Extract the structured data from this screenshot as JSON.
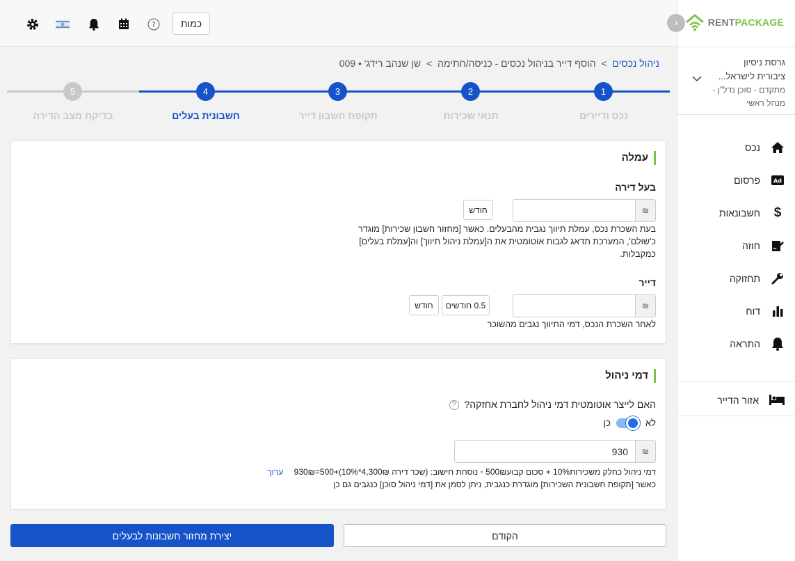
{
  "app": {
    "logo_rent": "RENT",
    "logo_package": "PACKAGE",
    "colors": {
      "primary": "#1652c8",
      "accent_green": "#7cc242",
      "inactive": "#c8c8c8"
    }
  },
  "header": {
    "quantity_button": "כמות",
    "icons": [
      "gear-icon",
      "israel-flag-icon",
      "bell-icon",
      "calendar-icon",
      "help-icon"
    ]
  },
  "account": {
    "name": "גרסת ניסיון ציבורית לישראל...",
    "name_line1": "גרסת ניסיון",
    "name_line2": "ציבורית לישראל...",
    "role_line1": "מתקדם - סוכן נדל\"ן -",
    "role_line2": "מנהל ראשי"
  },
  "sidebar": {
    "items": [
      {
        "label": "נכס",
        "icon": "home-icon"
      },
      {
        "label": "פרסום",
        "icon": "ad-icon"
      },
      {
        "label": "חשבונאות",
        "icon": "dollar-icon"
      },
      {
        "label": "חוזה",
        "icon": "contract-icon"
      },
      {
        "label": "תחזוקה",
        "icon": "wrench-icon"
      },
      {
        "label": "דוח",
        "icon": "bar-chart-icon"
      },
      {
        "label": "התראה",
        "icon": "bell-icon"
      }
    ],
    "tenant_zone": "אזור הדייר"
  },
  "breadcrumb": {
    "root": "ניהול נכסים",
    "sep": ">",
    "page": "הוסף דייר בניהול נכסים - כניסה/חתימה",
    "sep2": ">",
    "tenant": "שן שנהב רידג' • 009"
  },
  "stepper": {
    "steps": [
      {
        "num": "1",
        "label": "נכס ודיירים",
        "state": "done"
      },
      {
        "num": "2",
        "label": "תנאי שכירות",
        "state": "done"
      },
      {
        "num": "3",
        "label": "תקופת חשבון דייר",
        "state": "done"
      },
      {
        "num": "4",
        "label": "חשבונית בעלים",
        "state": "active"
      },
      {
        "num": "5",
        "label": "בדיקת מצב הדירה",
        "state": "pending"
      }
    ]
  },
  "commission": {
    "title": "עמלה",
    "owner": {
      "label": "בעל דירה",
      "currency": "₪",
      "value": "",
      "unit_chip": "חודש",
      "desc_line1": "בעת השכרת נכס, עמלת תיווך נגבית מהבעלים. כאשר [מחזור חשבון שכירות] מוגדר",
      "desc_line2": "כ'שולם', המערכת תדאג לגבות אוטומטית את ה[עמלת ניהול תיווך] וה[עמלת בעלים]",
      "desc_line3": "כמקבלות."
    },
    "tenant": {
      "label": "דייר",
      "currency": "₪",
      "value": "",
      "months_chip": "0.5 חודשים",
      "unit_chip": "חודש",
      "desc": "לאחר השכרת הנכס, דמי התיווך נגבים מהשוכר"
    }
  },
  "management": {
    "title": "דמי ניהול",
    "question": "האם לייצר אוטומטית דמי ניהול לחברת אחזקה?",
    "toggle_no": "לא",
    "toggle_yes": "כן",
    "toggle_on": true,
    "currency": "₪",
    "value": "930",
    "formula": "דמי ניהול כחלק משכירות10% + סכום קבוע500₪ ◦ נוסחת חישוב: (שכר דירה 4,300₪*10%)+500=930₪",
    "edit_link": "ערוך",
    "note": "כאשר [תקופת חשבונית השכירות] מוגדרת כנגבית, ניתן לסמן את [דמי ניהול סוכן] כנגבים גם כן"
  },
  "footer": {
    "prev_button": "הקודם",
    "create_button": "יצירת מחזור חשבונות לבעלים"
  }
}
